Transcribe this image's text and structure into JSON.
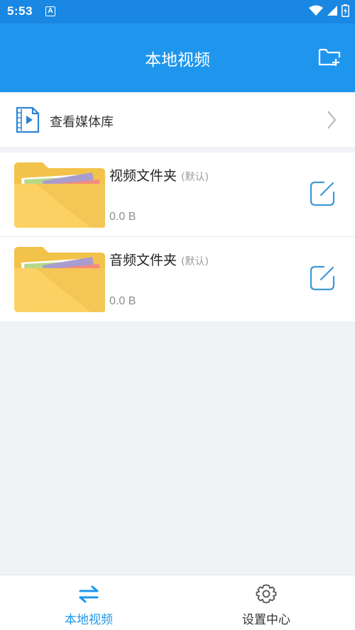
{
  "status_bar": {
    "time": "5:53",
    "notification_glyph": "A",
    "icons": [
      "wifi-icon",
      "signal-icon",
      "battery-icon"
    ]
  },
  "header": {
    "title": "本地视频",
    "action_icon": "new-folder-icon"
  },
  "media_library": {
    "label": "查看媒体库",
    "icon": "video-file-icon",
    "chevron_icon": "chevron-right-icon"
  },
  "folders": [
    {
      "name": "视频文件夹",
      "tag": "(默认)",
      "size": "0.0 B",
      "icon": "folder-icon",
      "edit_icon": "edit-icon"
    },
    {
      "name": "音频文件夹",
      "tag": "(默认)",
      "size": "0.0 B",
      "icon": "folder-icon",
      "edit_icon": "edit-icon"
    }
  ],
  "bottom_nav": {
    "items": [
      {
        "label": "本地视频",
        "icon": "transfer-arrows-icon",
        "active": true
      },
      {
        "label": "设置中心",
        "icon": "gear-icon",
        "active": false
      }
    ]
  },
  "colors": {
    "status_bar": "#1a87e2",
    "header": "#1f96ee",
    "accent": "#1f96ee",
    "background": "#f0f2f6"
  }
}
